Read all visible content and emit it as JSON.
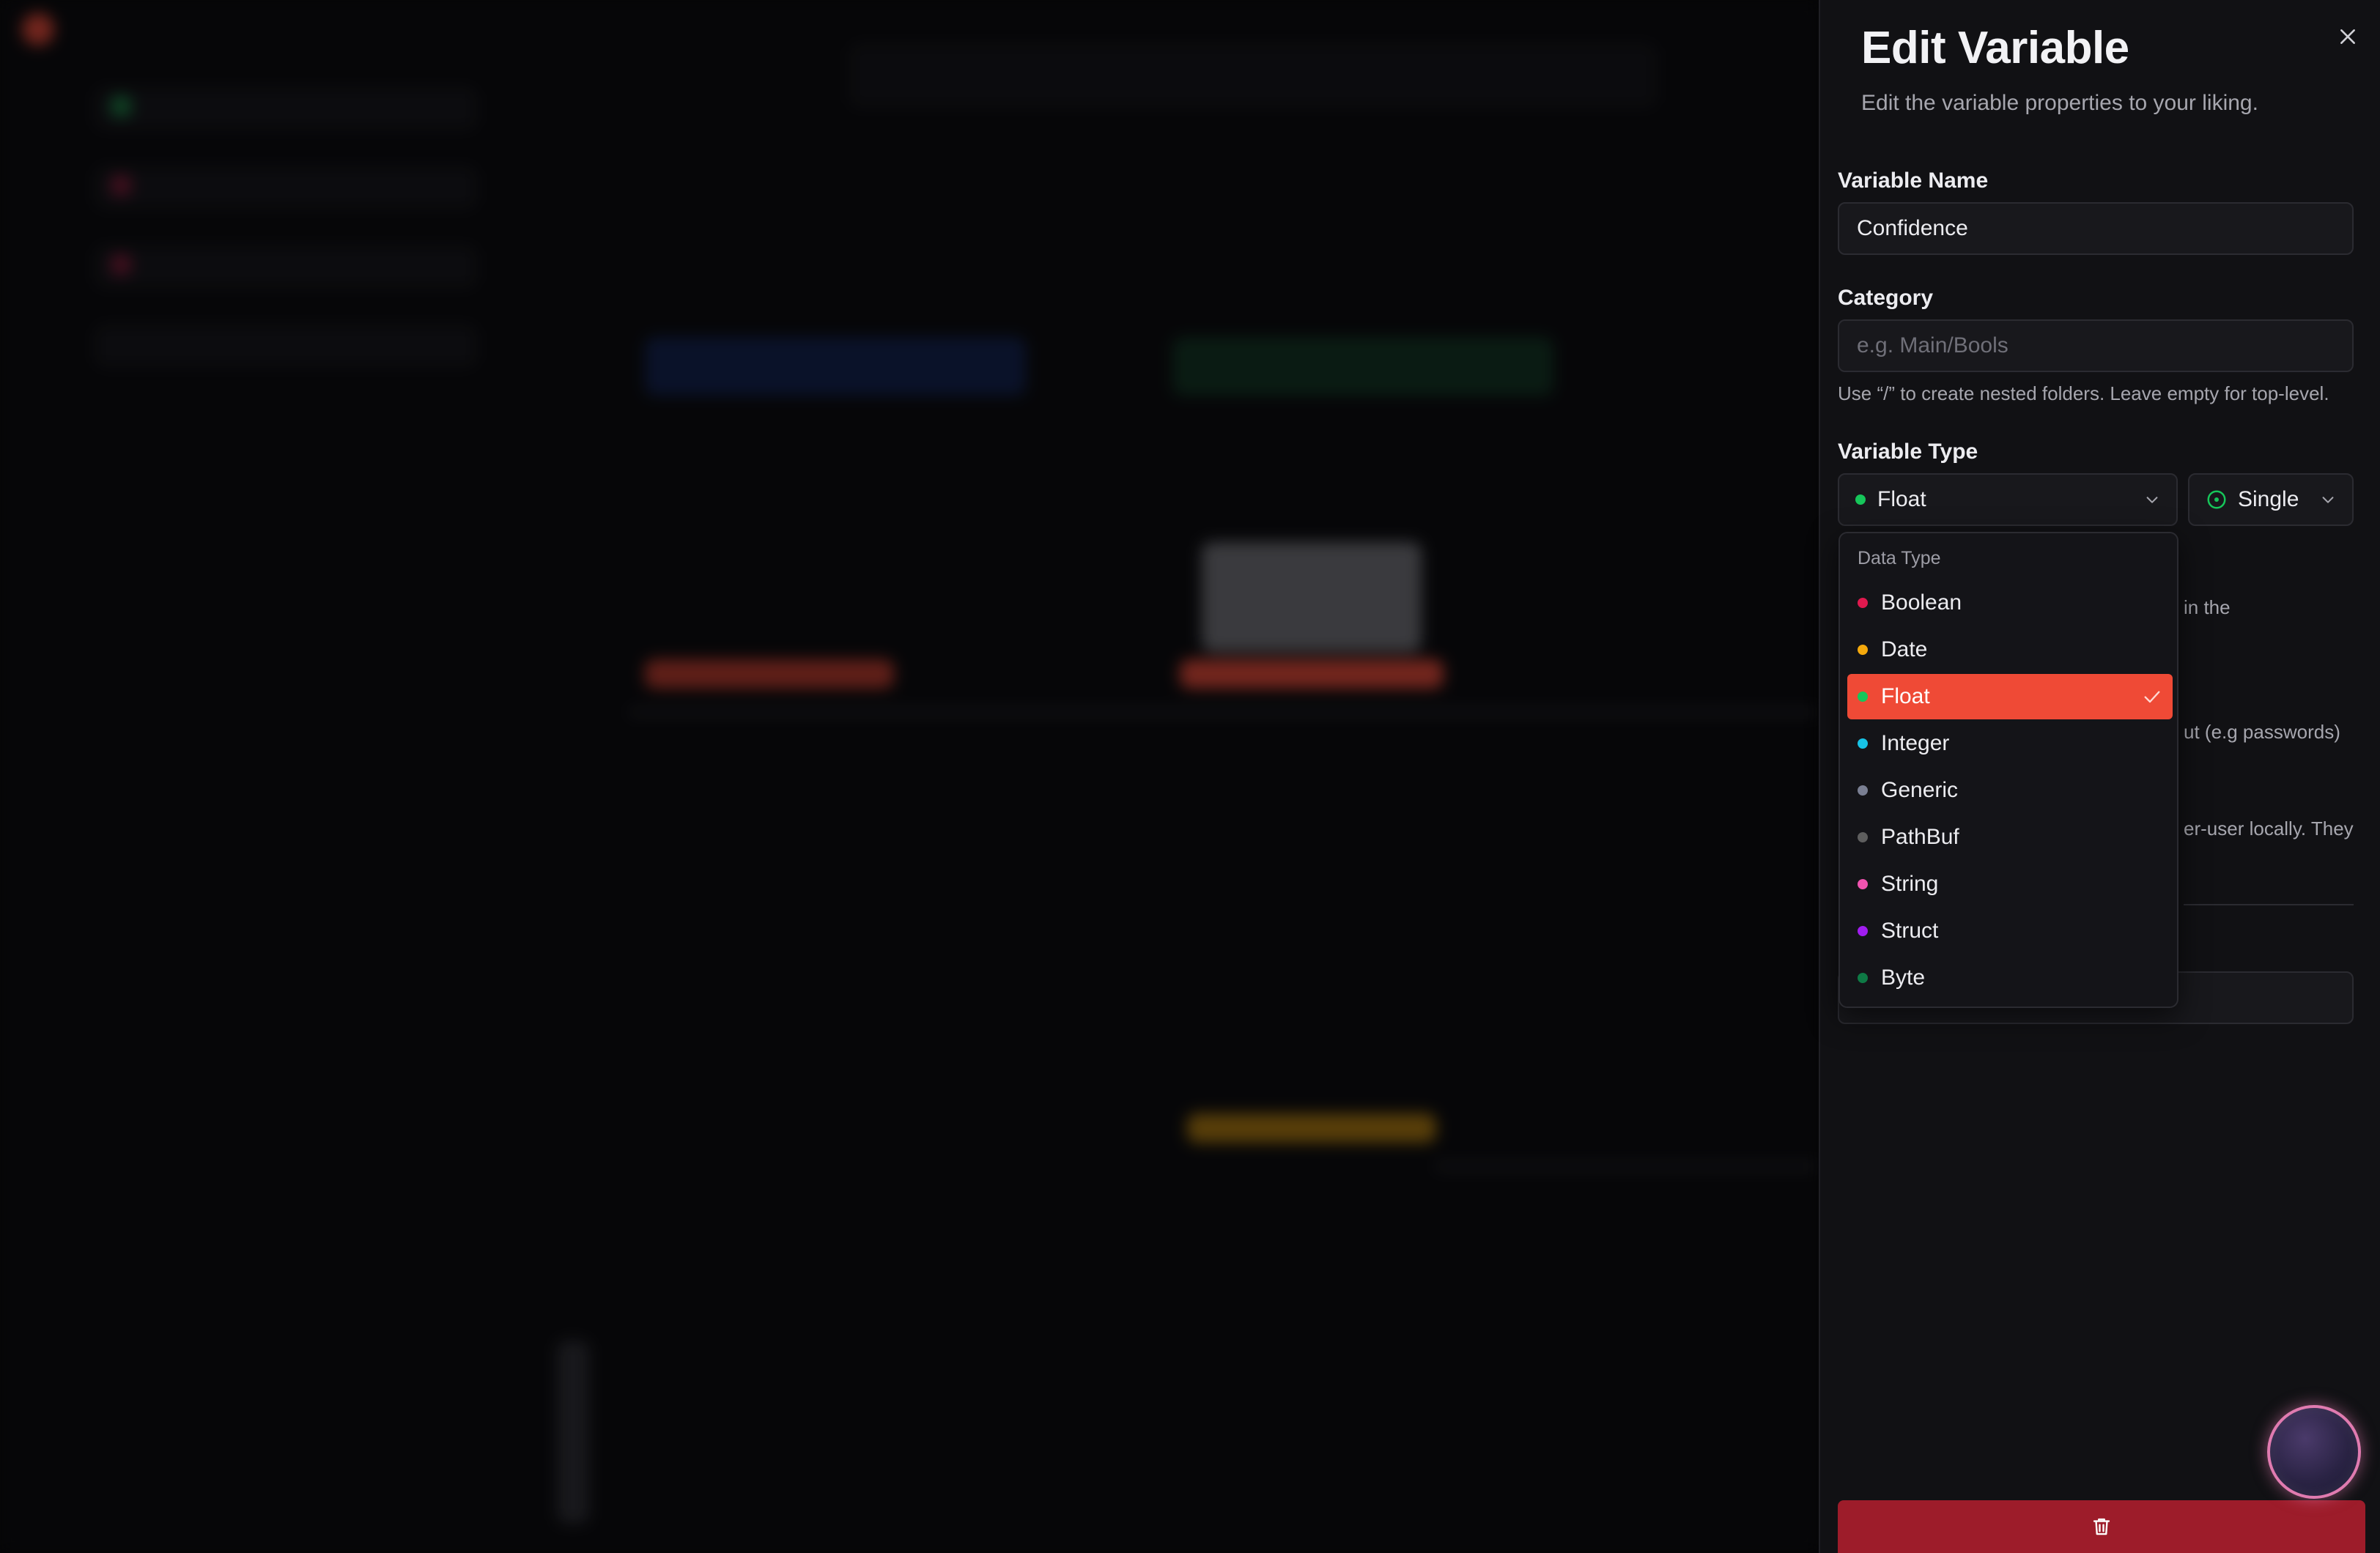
{
  "drawer": {
    "title": "Edit Variable",
    "subtitle": "Edit the variable properties to your liking."
  },
  "name_field": {
    "label": "Variable Name",
    "value": "Confidence"
  },
  "category_field": {
    "label": "Category",
    "placeholder": "e.g. Main/Bools",
    "helper": "Use “/” to create nested folders. Leave empty for top-level."
  },
  "type_field": {
    "label": "Variable Type",
    "selected_type": "Float",
    "selected_type_color": "#16c65a",
    "value_kind": "Single",
    "value_kind_color": "#16c65a"
  },
  "partial_helpers": {
    "helper_1": "in the",
    "helper_2": "ut (e.g passwords)",
    "helper_3": "er-user locally. They"
  },
  "dropdown": {
    "heading": "Data Type",
    "options": [
      {
        "label": "Boolean",
        "color": "#e0194e",
        "selected": false
      },
      {
        "label": "Date",
        "color": "#f5a90c",
        "selected": false
      },
      {
        "label": "Float",
        "color": "#16c65a",
        "selected": true
      },
      {
        "label": "Integer",
        "color": "#17c3e6",
        "selected": false
      },
      {
        "label": "Generic",
        "color": "#7a7f92",
        "selected": false
      },
      {
        "label": "PathBuf",
        "color": "#5e5e5e",
        "selected": false
      },
      {
        "label": "String",
        "color": "#f053b0",
        "selected": false
      },
      {
        "label": "Struct",
        "color": "#a11df0",
        "selected": false
      },
      {
        "label": "Byte",
        "color": "#0e7a45",
        "selected": false
      }
    ]
  },
  "colors": {
    "accent": "#ef4a36",
    "danger": "#9d1c2a",
    "orb_ring": "#e07bb0"
  },
  "icons": {
    "close": "close-icon",
    "chevron": "chevron-down-icon",
    "check": "check-icon",
    "single_value": "circle-dot-icon",
    "delete": "trash-icon"
  }
}
